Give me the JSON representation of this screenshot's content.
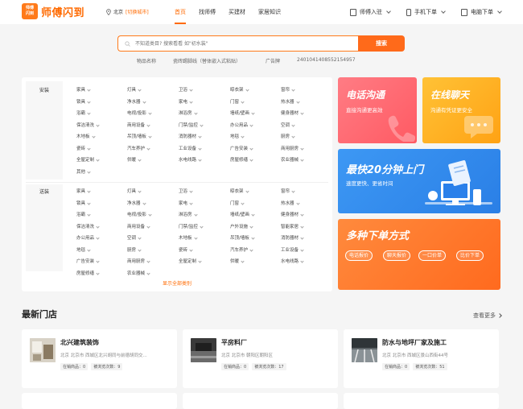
{
  "header": {
    "logo_badge_line1": "师傅",
    "logo_badge_line2": "闪到",
    "logo_text": "师傅闪到",
    "location": "北京",
    "switch_city": "[切换城市]",
    "nav": [
      "首页",
      "找师傅",
      "买建材",
      "家居知识"
    ],
    "right": [
      "师傅入驻",
      "手机下单",
      "电脑下单"
    ]
  },
  "search": {
    "placeholder": "不知道类目? 搜索看看 如\"初水装\"",
    "button": "搜索",
    "hot": [
      "物品名称",
      "瓷砖踢脚线（替体嵌入式粘贴）",
      "广告牌",
      "2401041408552154957"
    ]
  },
  "categories": {
    "install_label": "安装",
    "install_items": [
      "家具",
      "灯具",
      "卫浴",
      "晾衣架",
      "窗帘",
      "锁具",
      "净水器",
      "家电",
      "门窗",
      "热水器",
      "浴霸",
      "电视/投影",
      "淋浴房",
      "墙纸/壁画",
      "健身器材",
      "保洁清洗",
      "商用设备",
      "门禁/监控",
      "办公用品",
      "空调",
      "木地板",
      "吊顶/墙板",
      "消防器材",
      "地毯",
      "厨房",
      "瓷砖",
      "汽车养护",
      "工业设备",
      "广告安装",
      "商用厨房",
      "全屋定制",
      "供暖",
      "水电线路",
      "房屋修缮",
      "农业器械",
      "其他"
    ],
    "deliver_label": "送装",
    "deliver_items": [
      "家具",
      "灯具",
      "卫浴",
      "晾衣架",
      "窗帘",
      "锁具",
      "净水器",
      "家电",
      "门窗",
      "热水器",
      "浴霸",
      "电视/投影",
      "淋浴房",
      "墙纸/壁画",
      "健身器材",
      "保洁清洗",
      "商用设备",
      "门禁/监控",
      "户外设施",
      "智能家居",
      "办公用品",
      "空调",
      "木地板",
      "吊顶/墙板",
      "消防器材",
      "地毯",
      "厨房",
      "瓷砖",
      "汽车养护",
      "工业设备",
      "广告安装",
      "商用厨房",
      "全屋定制",
      "供暖",
      "水电线路",
      "房屋修缮",
      "农业器械"
    ],
    "show_all": "显示全部类别"
  },
  "promos": {
    "phone_title": "电话沟通",
    "phone_sub": "直接沟通更高效",
    "chat_title": "在线聊天",
    "chat_sub": "沟通有凭证更安全",
    "fast_title": "最快20分钟上门",
    "fast_sub": "速度更快、更省时间",
    "order_title": "多种下单方式",
    "order_pills": [
      "电话报价",
      "聊天报价",
      "一口价单",
      "比价下单"
    ]
  },
  "stores_section": {
    "title": "最新门店",
    "more": "查看更多",
    "stores": [
      {
        "name": "北兴建筑装饰",
        "addr": "北京 北京市 西城区北兴胡同与前德胡同交...",
        "tag1": "在销商品：0",
        "tag2": "被浏览次数：9"
      },
      {
        "name": "平房料厂",
        "addr": "北京 北京市 朝阳区朝阳区",
        "tag1": "在销商品：0",
        "tag2": "被浏览次数：17"
      },
      {
        "name": "防水与地坪厂家及施工",
        "addr": "北京 北京市 西城区景山西街44号",
        "tag1": "在销商品：0",
        "tag2": "被浏览次数：51"
      }
    ]
  },
  "colors": {
    "brand": "#ff6a00",
    "phone_card": "#ff6b73",
    "chat_card": "#ffb020",
    "fast_card": "#2f8ef0",
    "order_card": "#ff7a2e"
  }
}
